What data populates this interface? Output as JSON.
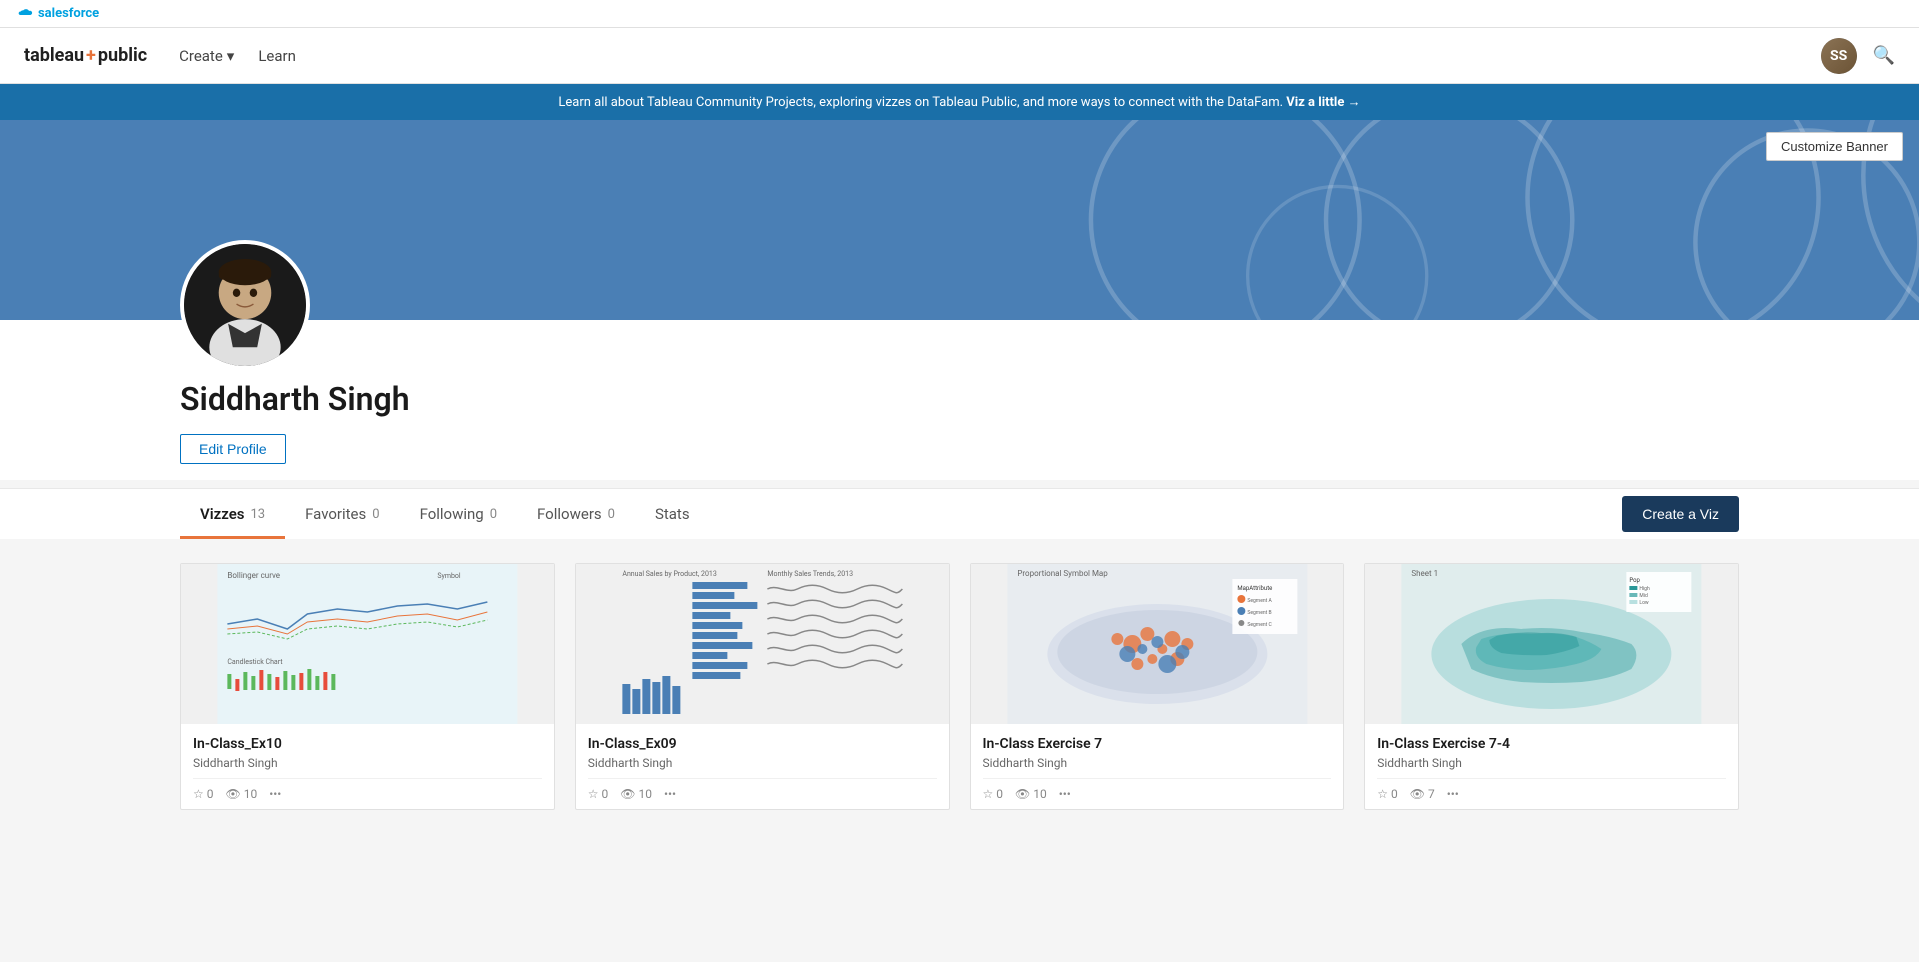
{
  "salesforce": {
    "logo_text": "salesforce"
  },
  "nav": {
    "logo": {
      "tableau": "tableau",
      "plus": "+",
      "public": "public"
    },
    "create_label": "Create",
    "learn_label": "Learn"
  },
  "banner": {
    "message": "Learn all about Tableau Community Projects, exploring vizzes on Tableau Public, and more ways to connect with the DataFam.",
    "link_text": "Viz a little →",
    "customize_button": "Customize Banner"
  },
  "profile": {
    "name": "Siddharth Singh",
    "edit_button": "Edit Profile"
  },
  "tabs": [
    {
      "label": "Vizzes",
      "count": "13",
      "active": true
    },
    {
      "label": "Favorites",
      "count": "0",
      "active": false
    },
    {
      "label": "Following",
      "count": "0",
      "active": false
    },
    {
      "label": "Followers",
      "count": "0",
      "active": false
    },
    {
      "label": "Stats",
      "count": "",
      "active": false
    }
  ],
  "create_viz_button": "Create a Viz",
  "vizzes": [
    {
      "title": "In-Class_Ex10",
      "author": "Siddharth Singh",
      "type": "line",
      "likes": "0",
      "views": "10",
      "comments": "..."
    },
    {
      "title": "In-Class_Ex09",
      "author": "Siddharth Singh",
      "type": "bar",
      "likes": "0",
      "views": "10",
      "comments": "..."
    },
    {
      "title": "In-Class Exercise 7",
      "author": "Siddharth Singh",
      "type": "map",
      "likes": "0",
      "views": "10",
      "comments": "..."
    },
    {
      "title": "In-Class Exercise 7-4",
      "author": "Siddharth Singh",
      "type": "geo",
      "likes": "0",
      "views": "7",
      "comments": "..."
    }
  ]
}
